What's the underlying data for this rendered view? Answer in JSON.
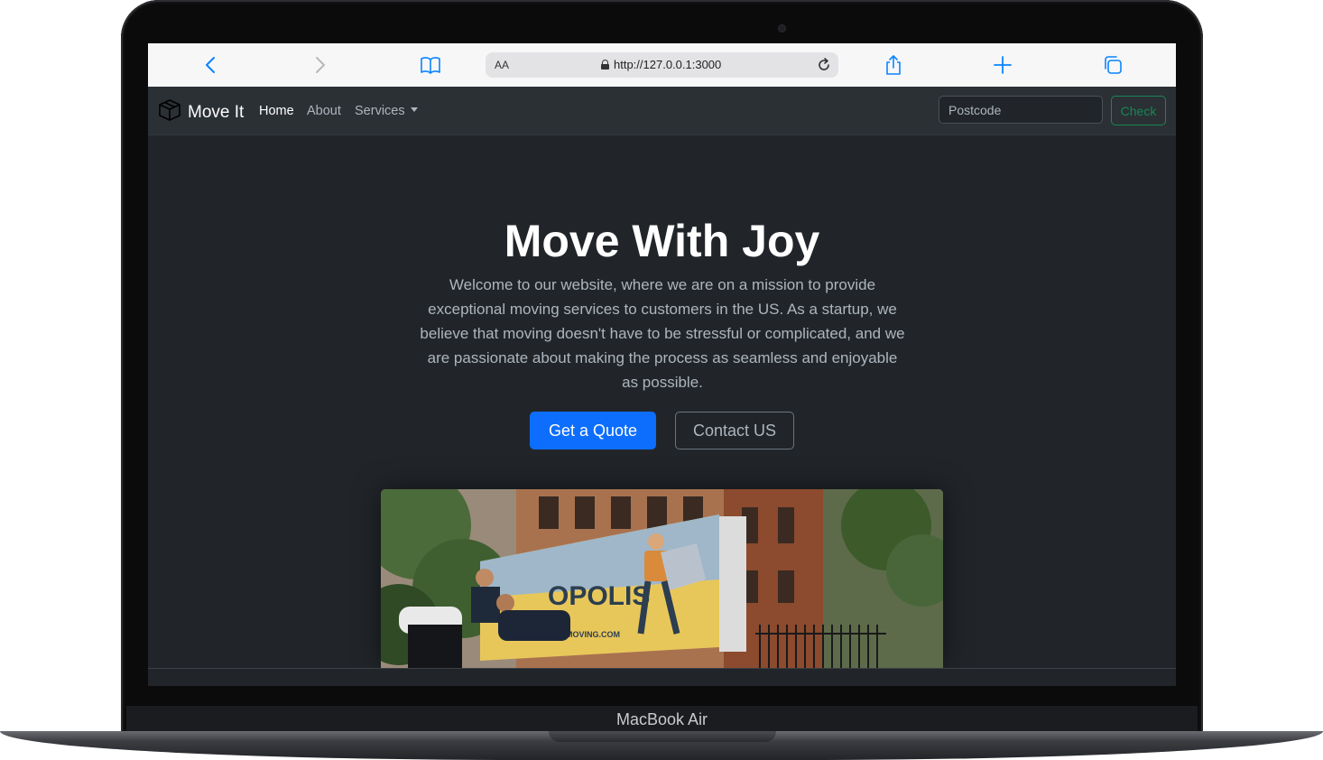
{
  "device": {
    "label": "MacBook Air"
  },
  "browser": {
    "aa_label": "AA",
    "url": "http://127.0.0.1:3000",
    "icons": [
      "back-icon",
      "forward-icon",
      "bookmarks-icon",
      "lock-icon",
      "reload-icon",
      "share-icon",
      "new-tab-icon",
      "tabs-icon"
    ],
    "accent": "#0a84ff"
  },
  "navbar": {
    "brand": "Move It",
    "brand_icon": "box-icon",
    "links": [
      {
        "label": "Home",
        "active": true
      },
      {
        "label": "About",
        "active": false
      },
      {
        "label": "Services",
        "active": false,
        "dropdown": true
      }
    ],
    "search": {
      "placeholder": "Postcode",
      "value": ""
    },
    "check_button": "Check"
  },
  "hero": {
    "title": "Move With Joy",
    "text": "Welcome to our website, where we are on a mission to provide exceptional moving services to customers in the US. As a startup, we believe that moving doesn't have to be stressful or complicated, and we are passionate about making the process as seamless and enjoyable as possible.",
    "primary_button": "Get a Quote",
    "secondary_button": "Contact US",
    "image": {
      "truck_text": "OPOLIS",
      "truck_subtext": "MOVING.COM"
    }
  },
  "colors": {
    "background": "#212529",
    "navbar": "#2b3035",
    "primary": "#0d6efd",
    "success": "#198754",
    "muted": "#adb5bd"
  }
}
